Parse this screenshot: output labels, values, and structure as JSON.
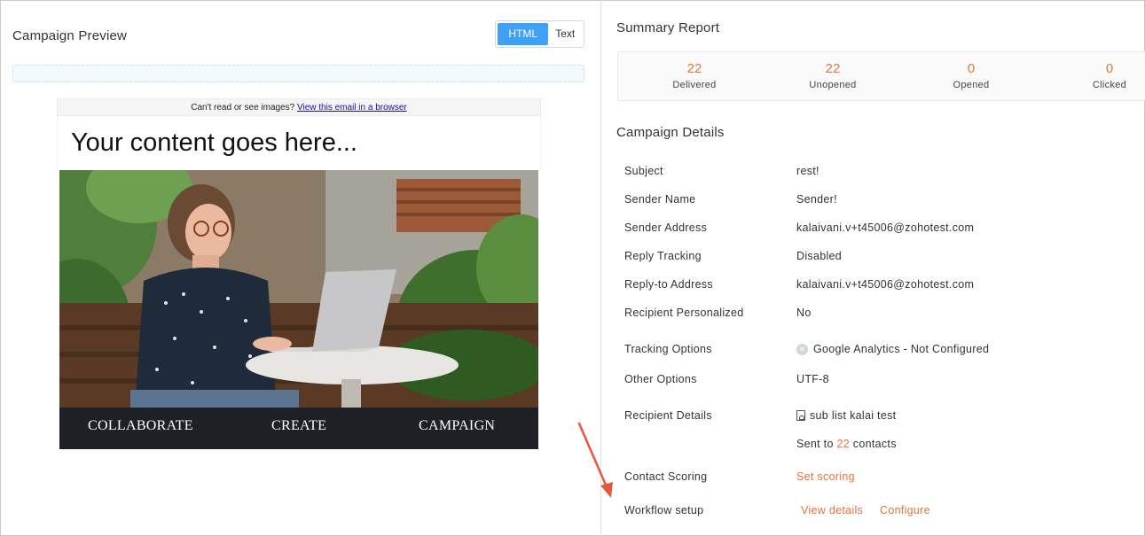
{
  "preview": {
    "title": "Campaign Preview",
    "toggle": {
      "html_label": "HTML",
      "text_label": "Text"
    },
    "email": {
      "top_bar_text": "Can't read or see images?",
      "top_bar_link": "View this email in a browser",
      "heading": "Your content goes here...",
      "footer_items": [
        "COLLABORATE",
        "CREATE",
        "CAMPAIGN"
      ]
    }
  },
  "summary": {
    "title": "Summary Report",
    "stats": [
      {
        "value": "22",
        "label": "Delivered"
      },
      {
        "value": "22",
        "label": "Unopened"
      },
      {
        "value": "0",
        "label": "Opened"
      },
      {
        "value": "0",
        "label": "Clicked"
      }
    ]
  },
  "details": {
    "title": "Campaign Details",
    "rows": {
      "subject": {
        "label": "Subject",
        "value": "rest!"
      },
      "sender_name": {
        "label": "Sender Name",
        "value": "Sender!"
      },
      "sender_address": {
        "label": "Sender Address",
        "value": "kalaivani.v+t45006@zohotest.com"
      },
      "reply_tracking": {
        "label": "Reply Tracking",
        "value": "Disabled"
      },
      "reply_to": {
        "label": "Reply-to Address",
        "value": "kalaivani.v+t45006@zohotest.com"
      },
      "personalized": {
        "label": "Recipient Personalized",
        "value": "No"
      },
      "tracking": {
        "label": "Tracking Options",
        "value": "Google Analytics - Not Configured"
      },
      "other": {
        "label": "Other Options",
        "value": "UTF-8"
      },
      "recipients": {
        "label": "Recipient Details",
        "list_name": "sub list kalai test",
        "sent_prefix": "Sent to",
        "sent_count": "22",
        "sent_suffix": "contacts"
      },
      "scoring": {
        "label": "Contact Scoring",
        "link": "Set scoring"
      },
      "workflow": {
        "label": "Workflow setup",
        "view_link": "View details",
        "configure_link": "Configure"
      }
    }
  },
  "colors": {
    "accent": "#e8743b",
    "toggle_active": "#3ea1f5"
  }
}
